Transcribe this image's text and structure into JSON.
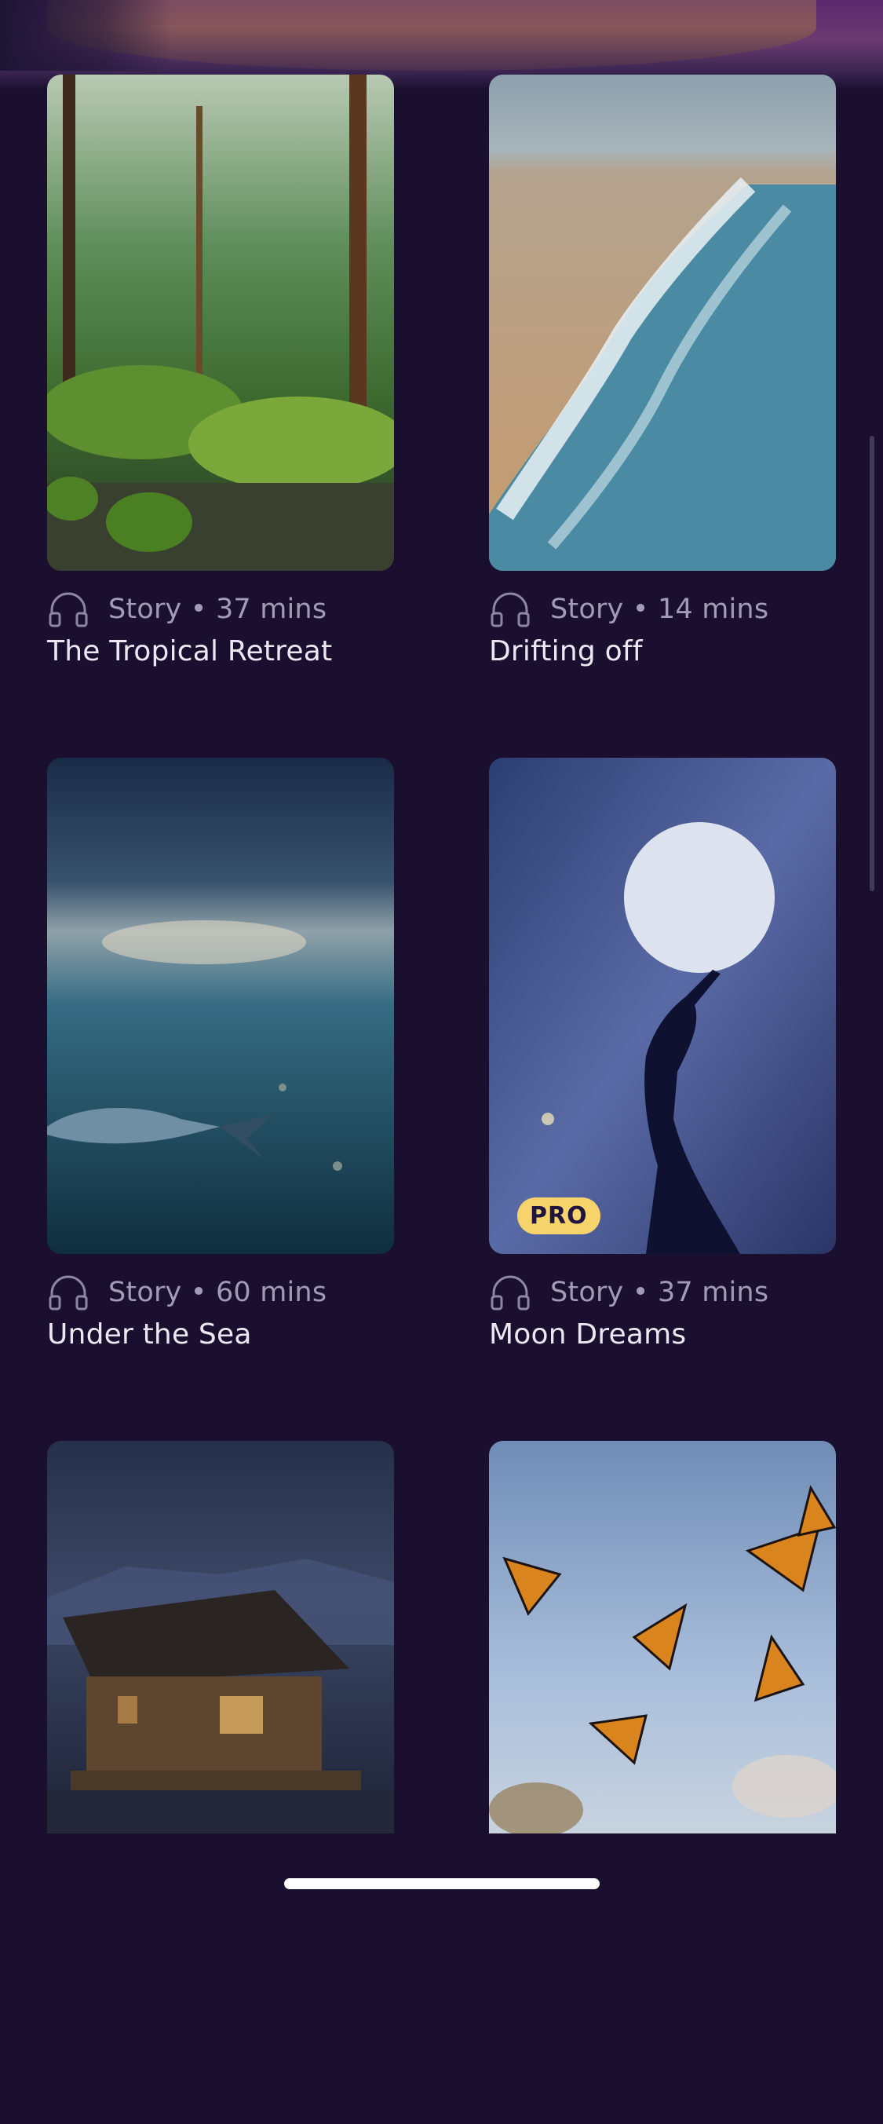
{
  "cards": [
    {
      "meta": "Story • 37 mins",
      "title": "The Tropical Retreat",
      "image_alt": "forest-stream",
      "pro": false
    },
    {
      "meta": "Story • 14 mins",
      "title": "Drifting off",
      "image_alt": "beach-waves",
      "pro": false
    },
    {
      "meta": "Story • 60 mins",
      "title": "Under the Sea",
      "image_alt": "underwater-whale",
      "pro": false
    },
    {
      "meta": "Story • 37 mins",
      "title": "Moon Dreams",
      "image_alt": "moon-silhouette",
      "pro": true,
      "badge": "PRO"
    },
    {
      "image_alt": "rain-cabin"
    },
    {
      "image_alt": "monarch-butterflies"
    }
  ],
  "icon": "headphones-icon",
  "colors": {
    "background": "#1a0f2e",
    "badge": "#f6d36b",
    "meta_text": "#a29bb5",
    "title_text": "#ece8f3"
  }
}
